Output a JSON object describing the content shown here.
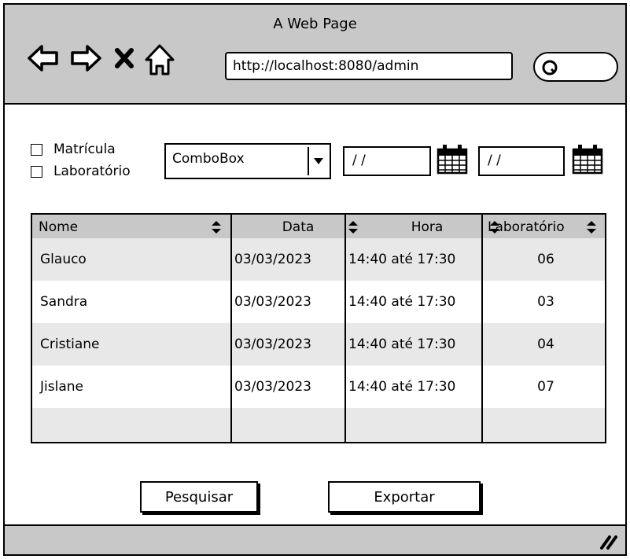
{
  "window": {
    "title": "A Web Page",
    "url": "http://localhost:8080/admin"
  },
  "filters": {
    "checkbox_matricula": "Matrícula",
    "checkbox_laboratorio": "Laboratório",
    "combobox_value": "ComboBox",
    "date_start": "/ /",
    "date_end": "/ /"
  },
  "table": {
    "columns": [
      "Nome",
      "Data",
      "Hora",
      "Laboratório"
    ],
    "rows": [
      [
        "Glauco",
        "03/03/2023",
        "14:40 até 17:30",
        "06"
      ],
      [
        "Sandra",
        "03/03/2023",
        "14:40 até 17:30",
        "03"
      ],
      [
        "Cristiane",
        "03/03/2023",
        "14:40 até 17:30",
        "04"
      ],
      [
        "Jislane",
        "03/03/2023",
        "14:40 até 17:30",
        "07"
      ]
    ]
  },
  "actions": {
    "search_label": "Pesquisar",
    "export_label": "Exportar"
  },
  "icons": {
    "back": "back-arrow-icon",
    "forward": "forward-arrow-icon",
    "stop": "close-icon",
    "home": "home-icon",
    "search": "search-icon",
    "calendar": "calendar-icon",
    "sort": "sort-icon",
    "dropdown": "chevron-down-icon",
    "resize": "resize-grip-icon"
  }
}
